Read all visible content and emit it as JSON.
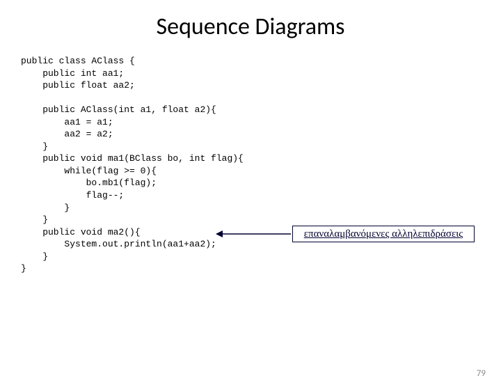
{
  "title": "Sequence Diagrams",
  "code": "public class AClass {\n    public int aa1;\n    public float aa2;\n\n    public AClass(int a1, float a2){\n        aa1 = a1;\n        aa2 = a2;\n    }\n    public void ma1(BClass bo, int flag){\n        while(flag >= 0){\n            bo.mb1(flag);\n            flag--;\n        }\n    }\n    public void ma2(){\n        System.out.println(aa1+aa2);\n    }\n}",
  "callout": "επαναλαμβανόμενες αλληλεπιδράσεις",
  "page_number": "79"
}
